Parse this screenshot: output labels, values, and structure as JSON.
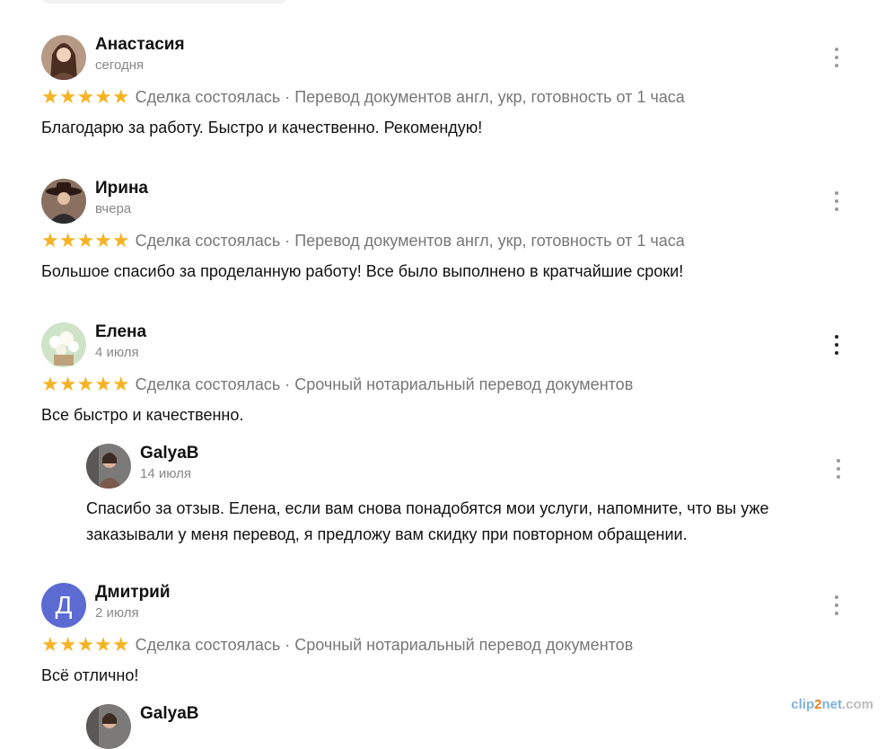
{
  "reviews": [
    {
      "name": "Анастасия",
      "date": "сегодня",
      "stars": "★★★★★",
      "meta": "Сделка состоялась · Перевод документов англ, укр, готовность от 1 часа",
      "text": "Благодарю за работу. Быстро и качественно. Рекомендую!"
    },
    {
      "name": "Ирина",
      "date": "вчера",
      "stars": "★★★★★",
      "meta": "Сделка состоялась · Перевод документов англ, укр, готовность от 1 часа",
      "text": "Большое спасибо за проделанную работу! Все было выполнено в кратчайшие сроки!"
    },
    {
      "name": "Елена",
      "date": "4 июля",
      "stars": "★★★★★",
      "meta": "Сделка состоялась · Срочный нотариальный перевод документов",
      "text": "Все быстро и качественно.",
      "reply": {
        "name": "GalyaB",
        "date": "14 июля",
        "text": "Спасибо за отзыв. Елена, если вам снова понадобятся мои услуги, напомните, что вы уже заказывали у меня перевод, я предложу вам скидку при повторном обращении."
      }
    },
    {
      "name": "Дмитрий",
      "avatar_letter": "Д",
      "date": "2 июля",
      "stars": "★★★★★",
      "meta": "Сделка состоялась · Срочный нотариальный перевод документов",
      "text": "Всё отлично!",
      "reply": {
        "name": "GalyaB"
      }
    }
  ],
  "watermark": {
    "a": "clip",
    "b": "2",
    "c": "net",
    "d": ".com"
  },
  "colors": {
    "star": "#f5b324",
    "avatar_letter_bg": "#5b6bd1"
  }
}
